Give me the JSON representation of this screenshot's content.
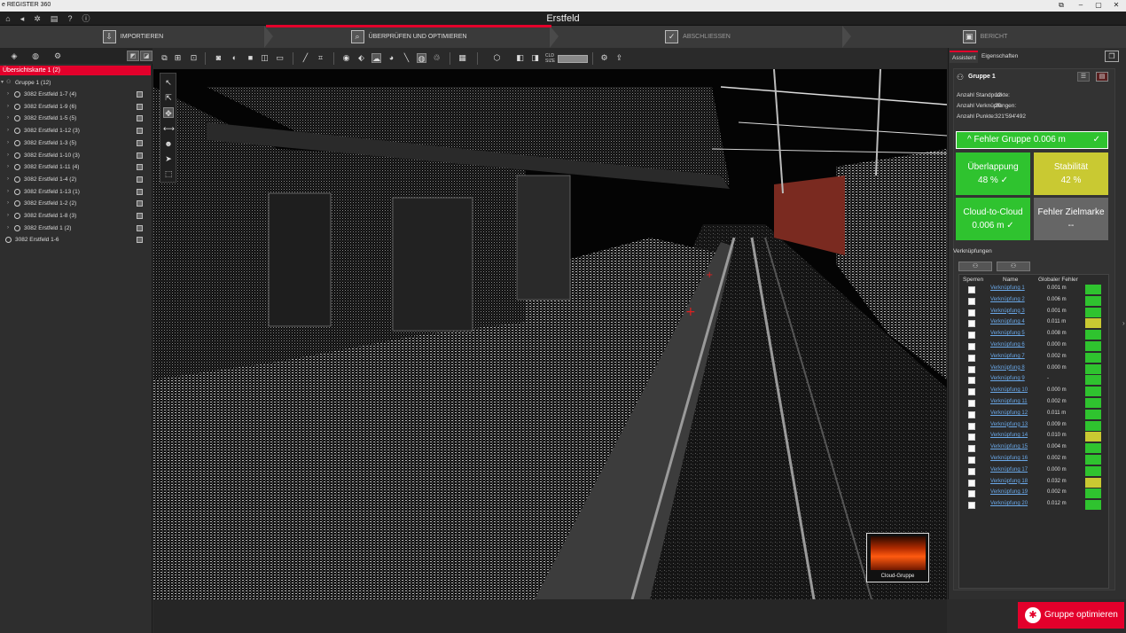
{
  "app": {
    "title": "e REGISTER 360",
    "project": "Erstfeld",
    "window_buttons": [
      "⧉",
      "–",
      "▢",
      "✕"
    ],
    "menu_icons": [
      "home-icon",
      "back-icon",
      "settings-icon",
      "database-icon",
      "help-icon",
      "info-icon"
    ]
  },
  "workflow": {
    "steps": [
      {
        "label": "IMPORTIEREN",
        "icon": "import-icon"
      },
      {
        "label": "ÜBERPRÜFEN UND OPTIMIEREN",
        "icon": "review-icon"
      },
      {
        "label": "ABSCHLIESSEN",
        "icon": "finalize-icon"
      },
      {
        "label": "BERICHT",
        "icon": "report-icon"
      }
    ],
    "active_index": 1
  },
  "left_panel": {
    "tab_icons": [
      "layers-icon",
      "globe-icon",
      "tree-icon"
    ],
    "root": "Übersichtskarte 1 (2)",
    "group": "Gruppe 1 (12)",
    "items": [
      "3082 Erstfeld 1-7 (4)",
      "3082 Erstfeld 1-9 (6)",
      "3082 Erstfeld 1-5 (5)",
      "3082 Erstfeld 1-12 (3)",
      "3082 Erstfeld 1-3 (5)",
      "3082 Erstfeld 1-10 (3)",
      "3082 Erstfeld 1-11 (4)",
      "3082 Erstfeld 1-4 (2)",
      "3082 Erstfeld 1-13 (1)",
      "3082 Erstfeld 1-2 (2)",
      "3082 Erstfeld 1-8 (3)",
      "3082 Erstfeld 1 (2)"
    ],
    "extra": "3082 Erstfeld 1-6"
  },
  "viewport": {
    "toolbar_size_label": "CLD SIZE",
    "thumbnail_caption": "Cloud-Gruppe"
  },
  "right_panel": {
    "tabs": [
      "Assistent",
      "Eigenschaften"
    ],
    "group_title": "Gruppe 1",
    "stats": [
      {
        "label": "Anzahl Standpunkte:",
        "value": "12"
      },
      {
        "label": "Anzahl Verknüpfungen:",
        "value": "20"
      },
      {
        "label": "Anzahl Punkte:",
        "value": "321'594'492"
      }
    ],
    "error_bar": "Fehler Gruppe 0.006 m",
    "tiles": [
      {
        "title": "Überlappung",
        "value": "48 %   ✓",
        "color": "green"
      },
      {
        "title": "Stabilität",
        "value": "42 %",
        "color": "yellow"
      },
      {
        "title": "Cloud-to-Cloud",
        "value": "0.006 m   ✓",
        "color": "green"
      },
      {
        "title": "Fehler Zielmarke",
        "value": "--",
        "color": "grey"
      }
    ],
    "links_title": "Verknüpfungen",
    "table_headers": [
      "Sperren",
      "Name",
      "Globaler Fehler"
    ],
    "links": [
      {
        "name": "Verknüpfung 1",
        "error": "0.001 m",
        "status": "green"
      },
      {
        "name": "Verknüpfung 2",
        "error": "0.006 m",
        "status": "green"
      },
      {
        "name": "Verknüpfung 3",
        "error": "0.001 m",
        "status": "green"
      },
      {
        "name": "Verknüpfung 4",
        "error": "0.011 m",
        "status": "yellow"
      },
      {
        "name": "Verknüpfung 5",
        "error": "0.008 m",
        "status": "green"
      },
      {
        "name": "Verknüpfung 6",
        "error": "0.000 m",
        "status": "green"
      },
      {
        "name": "Verknüpfung 7",
        "error": "0.002 m",
        "status": "green"
      },
      {
        "name": "Verknüpfung 8",
        "error": "0.000 m",
        "status": "green"
      },
      {
        "name": "Verknüpfung 9",
        "error": "-",
        "status": "green"
      },
      {
        "name": "Verknüpfung 10",
        "error": "0.000 m",
        "status": "green"
      },
      {
        "name": "Verknüpfung 11",
        "error": "0.002 m",
        "status": "green"
      },
      {
        "name": "Verknüpfung 12",
        "error": "0.011 m",
        "status": "green"
      },
      {
        "name": "Verknüpfung 13",
        "error": "0.009 m",
        "status": "green"
      },
      {
        "name": "Verknüpfung 14",
        "error": "0.010 m",
        "status": "yellow"
      },
      {
        "name": "Verknüpfung 15",
        "error": "0.004 m",
        "status": "green"
      },
      {
        "name": "Verknüpfung 16",
        "error": "0.002 m",
        "status": "green"
      },
      {
        "name": "Verknüpfung 17",
        "error": "0.000 m",
        "status": "green"
      },
      {
        "name": "Verknüpfung 18",
        "error": "0.032 m",
        "status": "yellow"
      },
      {
        "name": "Verknüpfung 19",
        "error": "0.002 m",
        "status": "green"
      },
      {
        "name": "Verknüpfung 20",
        "error": "0.012 m",
        "status": "green"
      }
    ],
    "optimize_button": "Gruppe optimieren"
  },
  "colors": {
    "accent": "#e3002b",
    "green": "#2fc32f",
    "yellow": "#c9c932",
    "grey": "#666666"
  }
}
